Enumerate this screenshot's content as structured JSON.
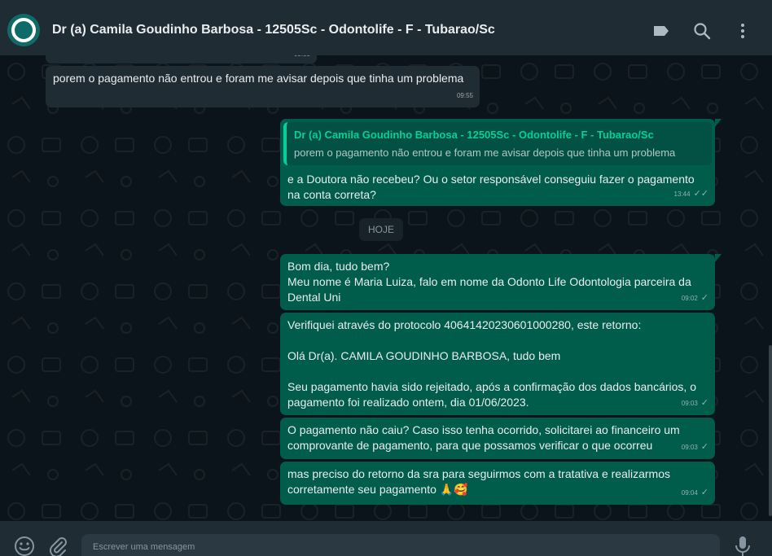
{
  "header": {
    "title": "Dr (a) Camila Goudinho Barbosa - 12505Sc - Odontolife - F - Tubarao/Sc"
  },
  "chat": {
    "date_chip": "HOJE",
    "messages": [
      {
        "text": "porem o pagamento não entrou e foram me avisar depois que tinha um problema",
        "time": "09:55",
        "dir": "in"
      },
      {
        "quote_name": "Dr (a) Camila Goudinho Barbosa - 12505Sc - Odontolife - F - Tubarao/Sc",
        "quote_text": "porem o pagamento não entrou e foram me avisar depois que tinha um problema",
        "text": "e a Doutora não recebeu? Ou o setor responsável conseguiu fazer o pagamento na conta correta?",
        "time": "13:44",
        "dir": "out"
      },
      {
        "text": "Bom dia, tudo bem?\nMeu nome é Maria Luiza, falo em nome da Odonto Life Odontologia parceira da Dental Uni",
        "time": "09:02",
        "dir": "out"
      },
      {
        "text": "Verifiquei através do protocolo 40641420230601000280, este retorno:\n\nOlá Dr(a). CAMILA GOUDINHO BARBOSA, tudo bem\n\nSeu pagamento havia sido rejeitado, após a confirmação dos dados bancários, o pagamento foi realizado ontem, dia 01/06/2023.",
        "time": "09:03",
        "dir": "out"
      },
      {
        "text": "O pagamento não caiu? Caso isso tenha ocorrido, solicitarei ao financeiro um comprovante de pagamento, para que possamos verificar o que ocorreu",
        "time": "09:03",
        "dir": "out"
      },
      {
        "text": "mas preciso do retorno da sra para seguirmos com a tratativa e realizarmos corretamente seu pagamento 🙏🥰",
        "time": "09:04",
        "dir": "out"
      }
    ],
    "partial_top_time": "09:55"
  },
  "footer": {
    "placeholder": "Escrever uma mensagem"
  },
  "colors": {
    "accent": "#06cf9c",
    "outgoing": "#005c4b",
    "incoming": "#202c33",
    "panel": "#202c33",
    "background": "#0b141a"
  },
  "icons": [
    "avatar-logo-icon",
    "label-icon",
    "search-icon",
    "menu-icon",
    "emoji-icon",
    "attach-icon",
    "mic-icon",
    "double-check-icon",
    "check-icon"
  ]
}
